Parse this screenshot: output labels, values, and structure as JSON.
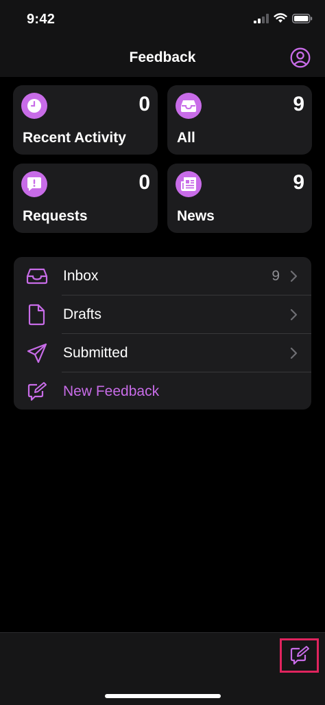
{
  "status_bar": {
    "time": "9:42"
  },
  "nav": {
    "title": "Feedback"
  },
  "tiles": [
    {
      "label": "Recent Activity",
      "count": "0",
      "icon": "clock-icon"
    },
    {
      "label": "All",
      "count": "9",
      "icon": "tray-icon"
    },
    {
      "label": "Requests",
      "count": "0",
      "icon": "exclamation-bubble-icon"
    },
    {
      "label": "News",
      "count": "9",
      "icon": "newspaper-icon"
    }
  ],
  "list": [
    {
      "label": "Inbox",
      "count": "9",
      "icon": "tray-icon"
    },
    {
      "label": "Drafts",
      "count": "",
      "icon": "document-icon"
    },
    {
      "label": "Submitted",
      "count": "",
      "icon": "paperplane-icon"
    },
    {
      "label": "New Feedback",
      "count": "",
      "icon": "compose-icon"
    }
  ],
  "colors": {
    "accent": "#c86ce8",
    "card": "#1c1c1e",
    "highlight": "#e0245e"
  }
}
